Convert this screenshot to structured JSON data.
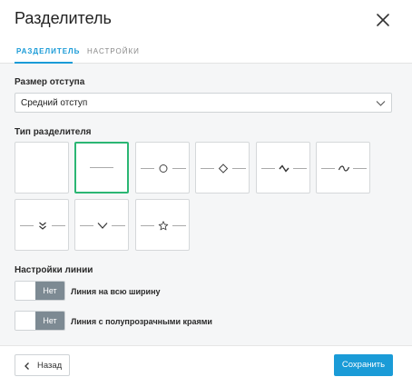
{
  "dialog": {
    "title": "Разделитель"
  },
  "tabs": [
    {
      "label": "РАЗДЕЛИТЕЛЬ",
      "active": true
    },
    {
      "label": "НАСТРОЙКИ",
      "active": false
    }
  ],
  "spacing": {
    "label": "Размер отступа",
    "value": "Средний отступ"
  },
  "divider_type": {
    "label": "Тип разделителя",
    "options": [
      {
        "name": "empty",
        "selected": false
      },
      {
        "name": "line",
        "selected": true
      },
      {
        "name": "circle",
        "selected": false
      },
      {
        "name": "diamond",
        "selected": false
      },
      {
        "name": "zigzag",
        "selected": false
      },
      {
        "name": "wave",
        "selected": false
      },
      {
        "name": "double-chevron",
        "selected": false
      },
      {
        "name": "chevron",
        "selected": false
      },
      {
        "name": "star",
        "selected": false
      }
    ]
  },
  "line_settings": {
    "label": "Настройки линии",
    "toggles": [
      {
        "state_label": "Нет",
        "label": "Линия на всю ширину"
      },
      {
        "state_label": "Нет",
        "label": "Линия с полупрозрачными краями"
      }
    ]
  },
  "footer": {
    "back_label": "Назад",
    "save_label": "Сохранить"
  },
  "colors": {
    "accent": "#1a9bd7",
    "selected_border": "#2bb673",
    "toggle_off": "#7d8a93"
  }
}
